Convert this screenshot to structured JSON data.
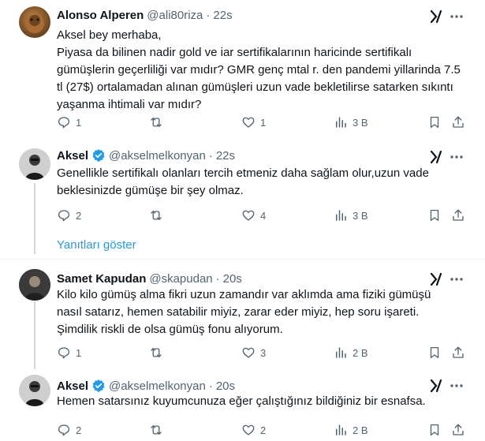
{
  "tweets": [
    {
      "name": "Alonso Alperen",
      "handle": "@ali80riza",
      "time": "22s",
      "lines": [
        "Aksel bey merhaba,",
        "Piyasa da bilinen nadir gold ve iar sertifikalarının haricinde sertifikalı",
        "gümüşlerin geçerliliği var mıdır? GMR genç mtal r. den pandemi yillarinda 7.5",
        "tl (27$) ortalamadan alınan gümüşleri uzun vade bekletilirse satarken sıkıntı",
        "yaşanma ihtimali var mıdır?"
      ],
      "replies": "1",
      "retweets": "",
      "likes": "1",
      "views": "3 B"
    },
    {
      "name": "Aksel",
      "handle": "@akselmelkonyan",
      "time": "22s",
      "lines": [
        "Genellikle sertifikalı olanları tercih etmeniz daha sağlam olur,uzun vade",
        "beklesinizde gümüşe bir şey olmaz."
      ],
      "replies": "2",
      "retweets": "",
      "likes": "4",
      "views": "3 B"
    },
    {
      "name": "Samet Kapudan",
      "handle": "@skapudan",
      "time": "20s",
      "lines": [
        "Kilo kilo gümüş alma fikri uzun zamandır var aklımda ama fiziki gümüşü",
        "nasıl satarız, hemen satabilir miyiz, zarar eder miyiz, hep soru işareti.",
        "Şimdilik riskli de olsa gümüş fonu alıyorum."
      ],
      "replies": "1",
      "retweets": "",
      "likes": "3",
      "views": "2 B"
    },
    {
      "name": "Aksel",
      "handle": "@akselmelkonyan",
      "time": "20s",
      "lines": [
        "Hemen satarsınız kuyumcunuza eğer çalıştığınız bildiğiniz bir esnafsa."
      ],
      "replies": "2",
      "retweets": "",
      "likes": "2",
      "views": "2 B"
    }
  ],
  "show_replies_label": "Yanıtları göster",
  "colors": {
    "verified": "#1d9bf0",
    "link": "#1d9bf0",
    "muted": "#536471"
  }
}
